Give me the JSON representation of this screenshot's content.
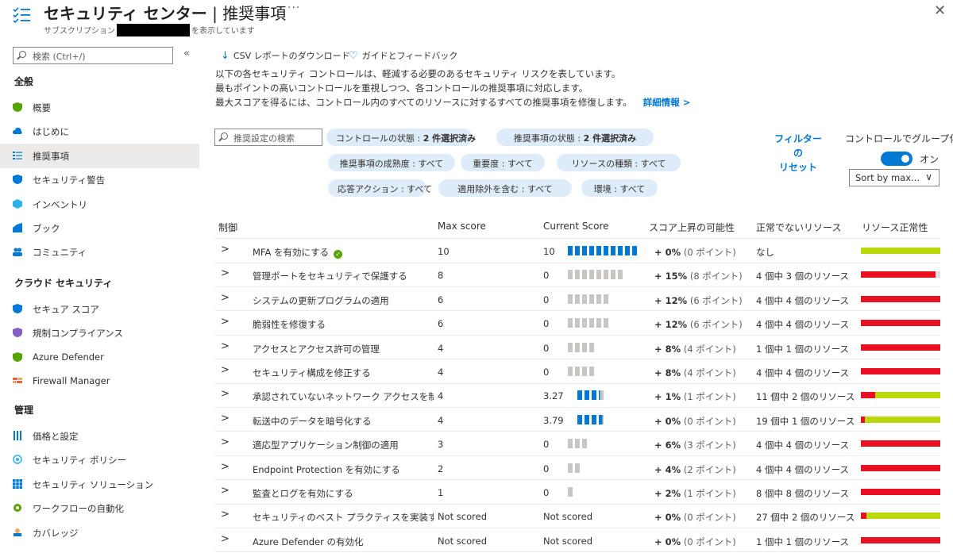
{
  "header": {
    "title_main": "セキュリティ センター",
    "title_sep": " | ",
    "title_page": "推奨事項",
    "more": "···",
    "sub_before": "サブスクリプション",
    "sub_after": "を表示しています",
    "close": "✕"
  },
  "sidebar": {
    "search_placeholder": "検索 (Ctrl+/)",
    "collapse": "«",
    "groups": [
      {
        "label": "全般",
        "items": [
          {
            "label": "概要",
            "icon": "overview-shield-icon",
            "color": "#57a300"
          },
          {
            "label": "はじめに",
            "icon": "cloud-icon",
            "color": "#0078d4"
          },
          {
            "label": "推奨事項",
            "icon": "list-icon",
            "color": "#0078d4",
            "selected": true
          },
          {
            "label": "セキュリティ警告",
            "icon": "shield-alert-icon",
            "color": "#0078d4"
          },
          {
            "label": "インベントリ",
            "icon": "cube-icon",
            "color": "#2bb0e8"
          },
          {
            "label": "ブック",
            "icon": "chart-icon",
            "color": "#0078d4"
          },
          {
            "label": "コミュニティ",
            "icon": "people-icon",
            "color": "#0078d4"
          }
        ]
      },
      {
        "label": "クラウド セキュリティ",
        "items": [
          {
            "label": "セキュア スコア",
            "icon": "secure-score-shield-icon",
            "color": "#0078d4"
          },
          {
            "label": "規制コンプライアンス",
            "icon": "compliance-shield-icon",
            "color": "#8661c5"
          },
          {
            "label": "Azure Defender",
            "icon": "defender-shield-icon",
            "color": "#57a300"
          },
          {
            "label": "Firewall Manager",
            "icon": "firewall-icon",
            "color": "#e8603c"
          }
        ]
      },
      {
        "label": "管理",
        "items": [
          {
            "label": "価格と設定",
            "icon": "settings-bars-icon",
            "color": "#0078d4"
          },
          {
            "label": "セキュリティ ポリシー",
            "icon": "policy-icon",
            "color": "#2bb0e8"
          },
          {
            "label": "セキュリティ ソリューション",
            "icon": "grid-icon",
            "color": "#0078d4"
          },
          {
            "label": "ワークフローの自動化",
            "icon": "workflow-icon",
            "color": "#57a300"
          },
          {
            "label": "カバレッジ",
            "icon": "coverage-icon",
            "color": "#0078d4"
          }
        ]
      }
    ]
  },
  "toolbar": {
    "download_label": "CSV レポートのダウンロード",
    "feedback_label": "ガイドとフィードバック"
  },
  "description": {
    "line1": "以下の各セキュリティ コントロールは、軽減する必要のあるセキュリティ リスクを表しています。",
    "line2": "最もポイントの高いコントロールを重視しつつ、各コントロールの推奨事項に対応します。",
    "line3": "最大スコアを得るには、コントロール内のすべてのリソースに対するすべての推奨事項を修復します。",
    "link": "詳細情報 >"
  },
  "filters": {
    "search_placeholder": "推奨設定の検索",
    "pills": [
      {
        "label": "コントロールの状態 : ",
        "value": "2 件選択済み"
      },
      {
        "label": "推奨事項の状態 : ",
        "value": "2 件選択済み"
      },
      {
        "label": "推奨事項の成熟度 : すべて",
        "value": ""
      },
      {
        "label": "重要度 : すべて",
        "value": ""
      },
      {
        "label": "リソースの種類 : すべて",
        "value": ""
      },
      {
        "label": "応答アクション : すべて",
        "value": ""
      },
      {
        "label": "適用除外を含む : すべて",
        "value": ""
      },
      {
        "label": "環境 : すべて",
        "value": ""
      }
    ],
    "reset_label": "フィルターの\nリセット",
    "group_by_label": "コントロールでグループ化:",
    "toggle_state": "オン",
    "sort_label": "Sort by max..."
  },
  "table": {
    "headers": [
      "制御",
      "Max score",
      "Current Score",
      "スコア上昇の可能性",
      "正常でないリソース",
      "リソース正常性"
    ],
    "rows": [
      {
        "name": "MFA を有効にする",
        "check": true,
        "max": "10",
        "current": "10",
        "max_n": 10,
        "cur_n": 10,
        "inc": "+ 0%",
        "pts": "(0 ポイント)",
        "res": "なし",
        "unhealthy": 0,
        "healthy": 1
      },
      {
        "name": "管理ポートをセキュリティで保護する",
        "max": "8",
        "current": "0",
        "max_n": 8,
        "cur_n": 0,
        "inc": "+ 15%",
        "pts": "(8 ポイント)",
        "res": "4 個中 3 個のリソース",
        "unhealthy": 0.94,
        "healthy": 0
      },
      {
        "name": "システムの更新プログラムの適用",
        "max": "6",
        "current": "0",
        "max_n": 6,
        "cur_n": 0,
        "inc": "+ 12%",
        "pts": "(6 ポイント)",
        "res": "4 個中 4 個のリソース",
        "unhealthy": 1,
        "healthy": 0
      },
      {
        "name": "脆弱性を修復する",
        "max": "6",
        "current": "0",
        "max_n": 6,
        "cur_n": 0,
        "inc": "+ 12%",
        "pts": "(6 ポイント)",
        "res": "4 個中 4 個のリソース",
        "unhealthy": 1,
        "healthy": 0
      },
      {
        "name": "アクセスとアクセス許可の管理",
        "max": "4",
        "current": "0",
        "max_n": 4,
        "cur_n": 0,
        "inc": "+ 8%",
        "pts": "(4 ポイント)",
        "res": "1 個中 1 個のリソース",
        "unhealthy": 1,
        "healthy": 0
      },
      {
        "name": "セキュリティ構成を修正する",
        "max": "4",
        "current": "0",
        "max_n": 4,
        "cur_n": 0,
        "inc": "+ 8%",
        "pts": "(4 ポイント)",
        "res": "4 個中 4 個のリソース",
        "unhealthy": 1,
        "healthy": 0
      },
      {
        "name": "承認されていないネットワーク アクセスを制限す",
        "max": "4",
        "current": "3.27",
        "max_n": 4,
        "cur_n": 3.27,
        "inc": "+ 1%",
        "pts": "(1 ポイント)",
        "res": "11 個中 2 個のリソース",
        "unhealthy": 0.18,
        "healthy": 0.82
      },
      {
        "name": "転送中のデータを暗号化する",
        "max": "4",
        "current": "3.79",
        "max_n": 4,
        "cur_n": 3.79,
        "inc": "+ 0%",
        "pts": "(0 ポイント)",
        "res": "19 個中 1 個のリソース",
        "unhealthy": 0.05,
        "healthy": 0.95
      },
      {
        "name": "適応型アプリケーション制御の適用",
        "max": "3",
        "current": "0",
        "max_n": 3,
        "cur_n": 0,
        "inc": "+ 6%",
        "pts": "(3 ポイント)",
        "res": "4 個中 4 個のリソース",
        "unhealthy": 1,
        "healthy": 0
      },
      {
        "name": "Endpoint Protection を有効にする",
        "max": "2",
        "current": "0",
        "max_n": 2,
        "cur_n": 0,
        "inc": "+ 4%",
        "pts": "(2 ポイント)",
        "res": "4 個中 4 個のリソース",
        "unhealthy": 1,
        "healthy": 0
      },
      {
        "name": "監査とログを有効にする",
        "max": "1",
        "current": "0",
        "max_n": 1,
        "cur_n": 0,
        "inc": "+ 2%",
        "pts": "(1 ポイント)",
        "res": "8 個中 8 個のリソース",
        "unhealthy": 1,
        "healthy": 0
      },
      {
        "name": "セキュリティのベスト プラクティスを実装する",
        "max": "Not scored",
        "current": "Not scored",
        "max_n": 0,
        "cur_n": 0,
        "inc": "+ 0%",
        "pts": "(0 ポイント)",
        "res": "27 個中 2 個のリソース",
        "unhealthy": 0.07,
        "healthy": 0.93
      },
      {
        "name": "Azure Defender の有効化",
        "max": "Not scored",
        "current": "Not scored",
        "max_n": 0,
        "cur_n": 0,
        "inc": "+ 0%",
        "pts": "(0 ポイント)",
        "res": "1 個中 1 個のリソース",
        "unhealthy": 1,
        "healthy": 0
      }
    ]
  },
  "colors": {
    "accent": "#0078d4",
    "unhealthy": "#e81123",
    "healthy": "#bad80a",
    "segment_on": "#0078d4",
    "segment_off": "#c8c6c4"
  }
}
